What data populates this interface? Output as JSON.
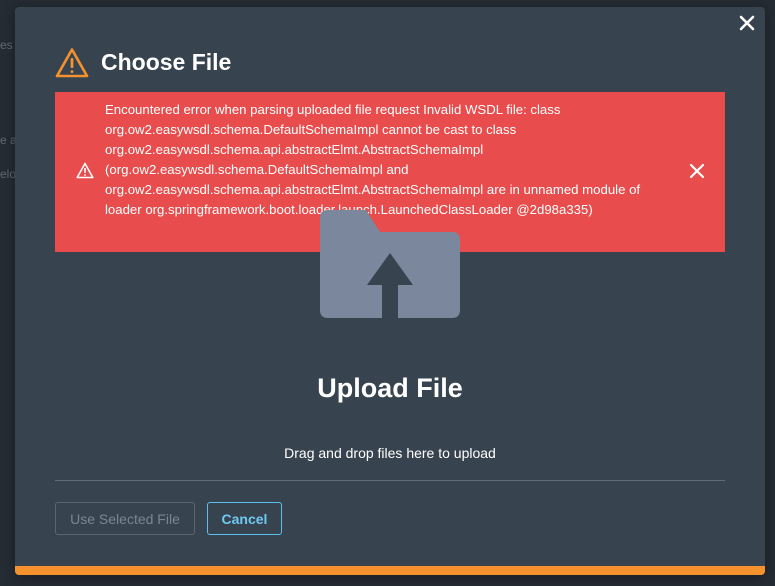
{
  "background": {
    "fragments": [
      "es",
      "e a",
      "elo"
    ]
  },
  "dialog": {
    "title": "Choose File",
    "error_message": "Encountered error when parsing uploaded file request Invalid WSDL file: class org.ow2.easywsdl.schema.DefaultSchemaImpl cannot be cast to class org.ow2.easywsdl.schema.api.abstractElmt.AbstractSchemaImpl (org.ow2.easywsdl.schema.DefaultSchemaImpl and org.ow2.easywsdl.schema.api.abstractElmt.AbstractSchemaImpl are in unnamed module of loader org.springframework.boot.loader.launch.LaunchedClassLoader @2d98a335)",
    "upload_title": "Upload File",
    "upload_hint": "Drag and drop files here to upload",
    "buttons": {
      "use_selected": "Use Selected File",
      "cancel": "Cancel"
    }
  },
  "icons": {
    "title_icon": "warning-triangle-icon",
    "error_icon": "warning-triangle-icon",
    "close_dialog": "close-icon",
    "dismiss_error": "close-icon",
    "upload_art": "folder-upload-icon"
  },
  "colors": {
    "modal_bg": "#37434e",
    "error_bg": "#e84c4c",
    "warning": "#f5922e",
    "accent": "#5bc0ec",
    "folder": "#7a879d"
  }
}
